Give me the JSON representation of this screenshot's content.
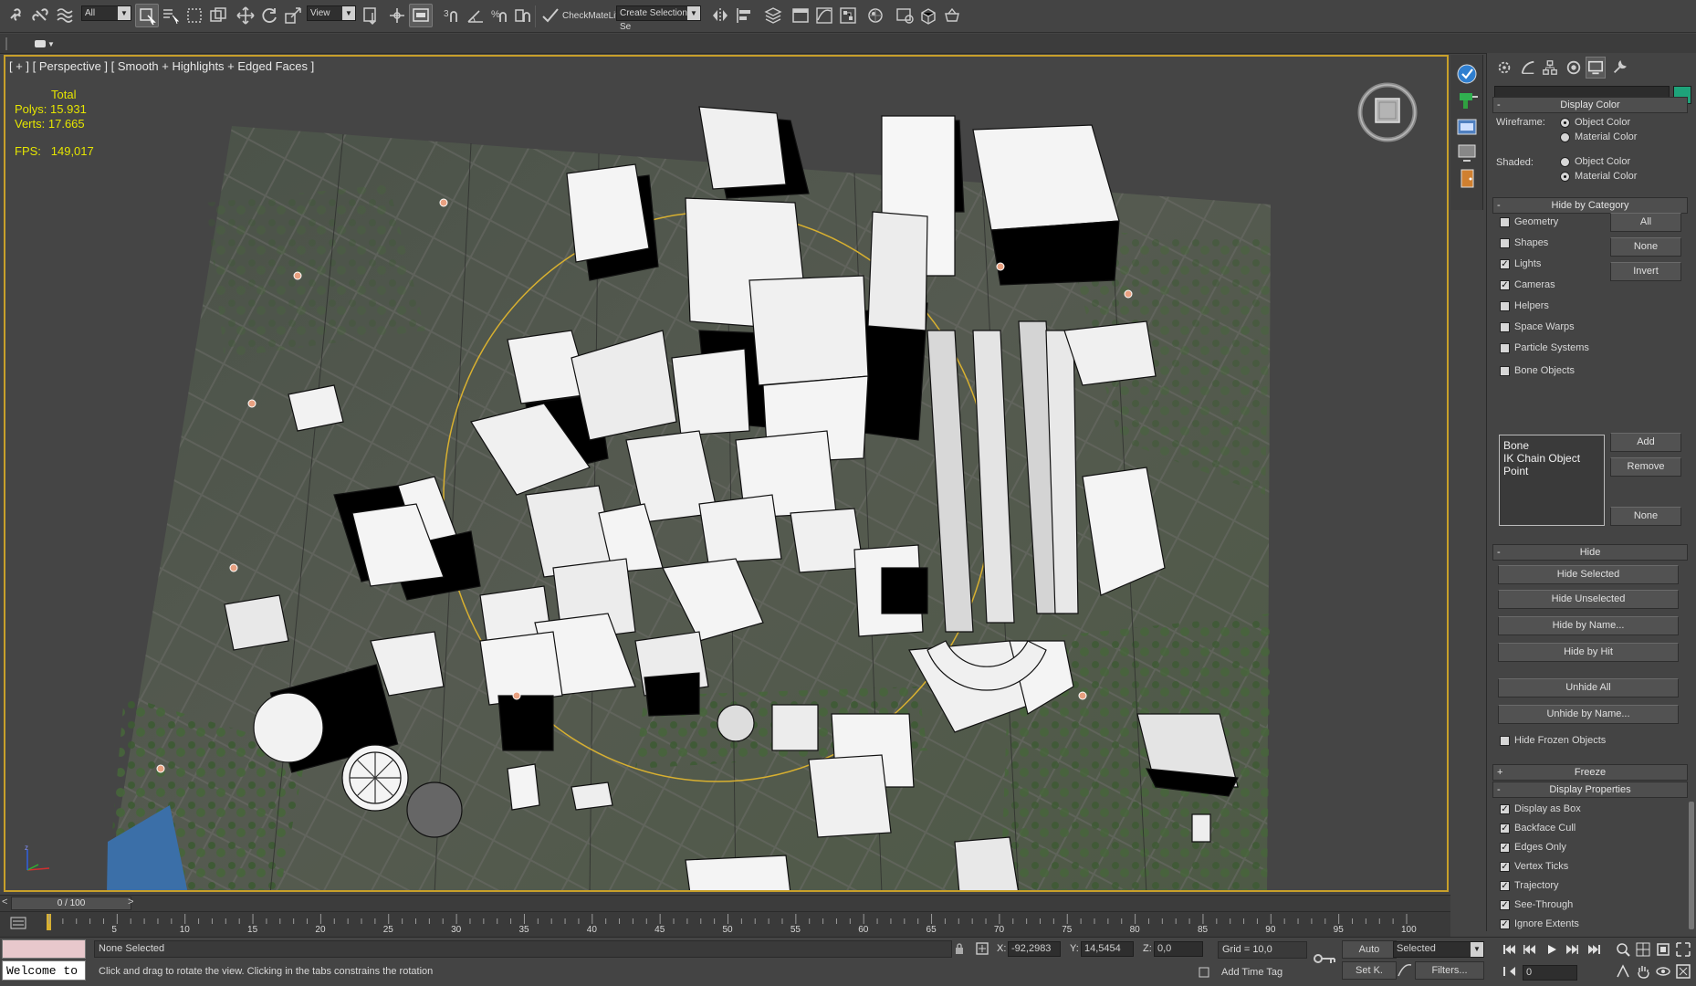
{
  "toolbar": {
    "selection_filter": "All",
    "ref_coord": "View",
    "checkmate_label": "CheckMateLite",
    "named_selection": "Create Selection Se"
  },
  "viewport": {
    "label": "[ + ] [ Perspective ] [ Smooth + Highlights + Edged Faces ]",
    "stats_total": "Total",
    "polys_label": "Polys:",
    "polys_value": "15.931",
    "verts_label": "Verts:",
    "verts_value": "17.665",
    "fps_label": "FPS:",
    "fps_value": "149,017"
  },
  "command_panel": {
    "display_color": {
      "title": "Display Color",
      "wireframe_label": "Wireframe:",
      "shaded_label": "Shaded:",
      "object_color": "Object Color",
      "material_color": "Material Color"
    },
    "hide_by_category": {
      "title": "Hide by Category",
      "items": [
        {
          "label": "Geometry",
          "checked": false
        },
        {
          "label": "Shapes",
          "checked": false
        },
        {
          "label": "Lights",
          "checked": true
        },
        {
          "label": "Cameras",
          "checked": true
        },
        {
          "label": "Helpers",
          "checked": false
        },
        {
          "label": "Space Warps",
          "checked": false
        },
        {
          "label": "Particle Systems",
          "checked": false
        },
        {
          "label": "Bone Objects",
          "checked": false
        }
      ],
      "btn_all": "All",
      "btn_none": "None",
      "btn_invert": "Invert",
      "list": [
        "Bone",
        "IK Chain Object",
        "Point"
      ],
      "btn_add": "Add",
      "btn_remove": "Remove",
      "btn_none2": "None"
    },
    "hide": {
      "title": "Hide",
      "hide_selected": "Hide Selected",
      "hide_unselected": "Hide Unselected",
      "hide_by_name": "Hide by Name...",
      "hide_by_hit": "Hide by Hit",
      "unhide_all": "Unhide All",
      "unhide_by_name": "Unhide by Name...",
      "hide_frozen": "Hide Frozen Objects"
    },
    "freeze": {
      "title": "Freeze"
    },
    "display_properties": {
      "title": "Display Properties",
      "items": [
        {
          "label": "Display as Box",
          "checked": false
        },
        {
          "label": "Backface Cull",
          "checked": false
        },
        {
          "label": "Edges Only",
          "checked": true
        },
        {
          "label": "Vertex Ticks",
          "checked": false
        },
        {
          "label": "Trajectory",
          "checked": false
        },
        {
          "label": "See-Through",
          "checked": false
        },
        {
          "label": "Ignore Extents",
          "checked": false
        }
      ]
    }
  },
  "timeline": {
    "frame_display": "0 / 100",
    "ticks": [
      "5",
      "10",
      "15",
      "20",
      "25",
      "30",
      "35",
      "40",
      "45",
      "50",
      "55",
      "60",
      "65",
      "70",
      "75",
      "80",
      "85",
      "90",
      "95",
      "100"
    ]
  },
  "status": {
    "maxscript_text": "Welcome to",
    "selection": "None Selected",
    "prompt": "Click and drag to rotate the view.  Clicking in the tabs constrains the rotation",
    "x_label": "X:",
    "x_value": "-92,2983",
    "y_label": "Y:",
    "y_value": "14,5454",
    "z_label": "Z:",
    "z_value": "0,0",
    "grid": "Grid = 10,0",
    "add_time_tag": "Add Time Tag",
    "auto": "Auto",
    "set_key": "Set K.",
    "key_filter": "Selected",
    "filters": "Filters...",
    "frame": "0"
  }
}
